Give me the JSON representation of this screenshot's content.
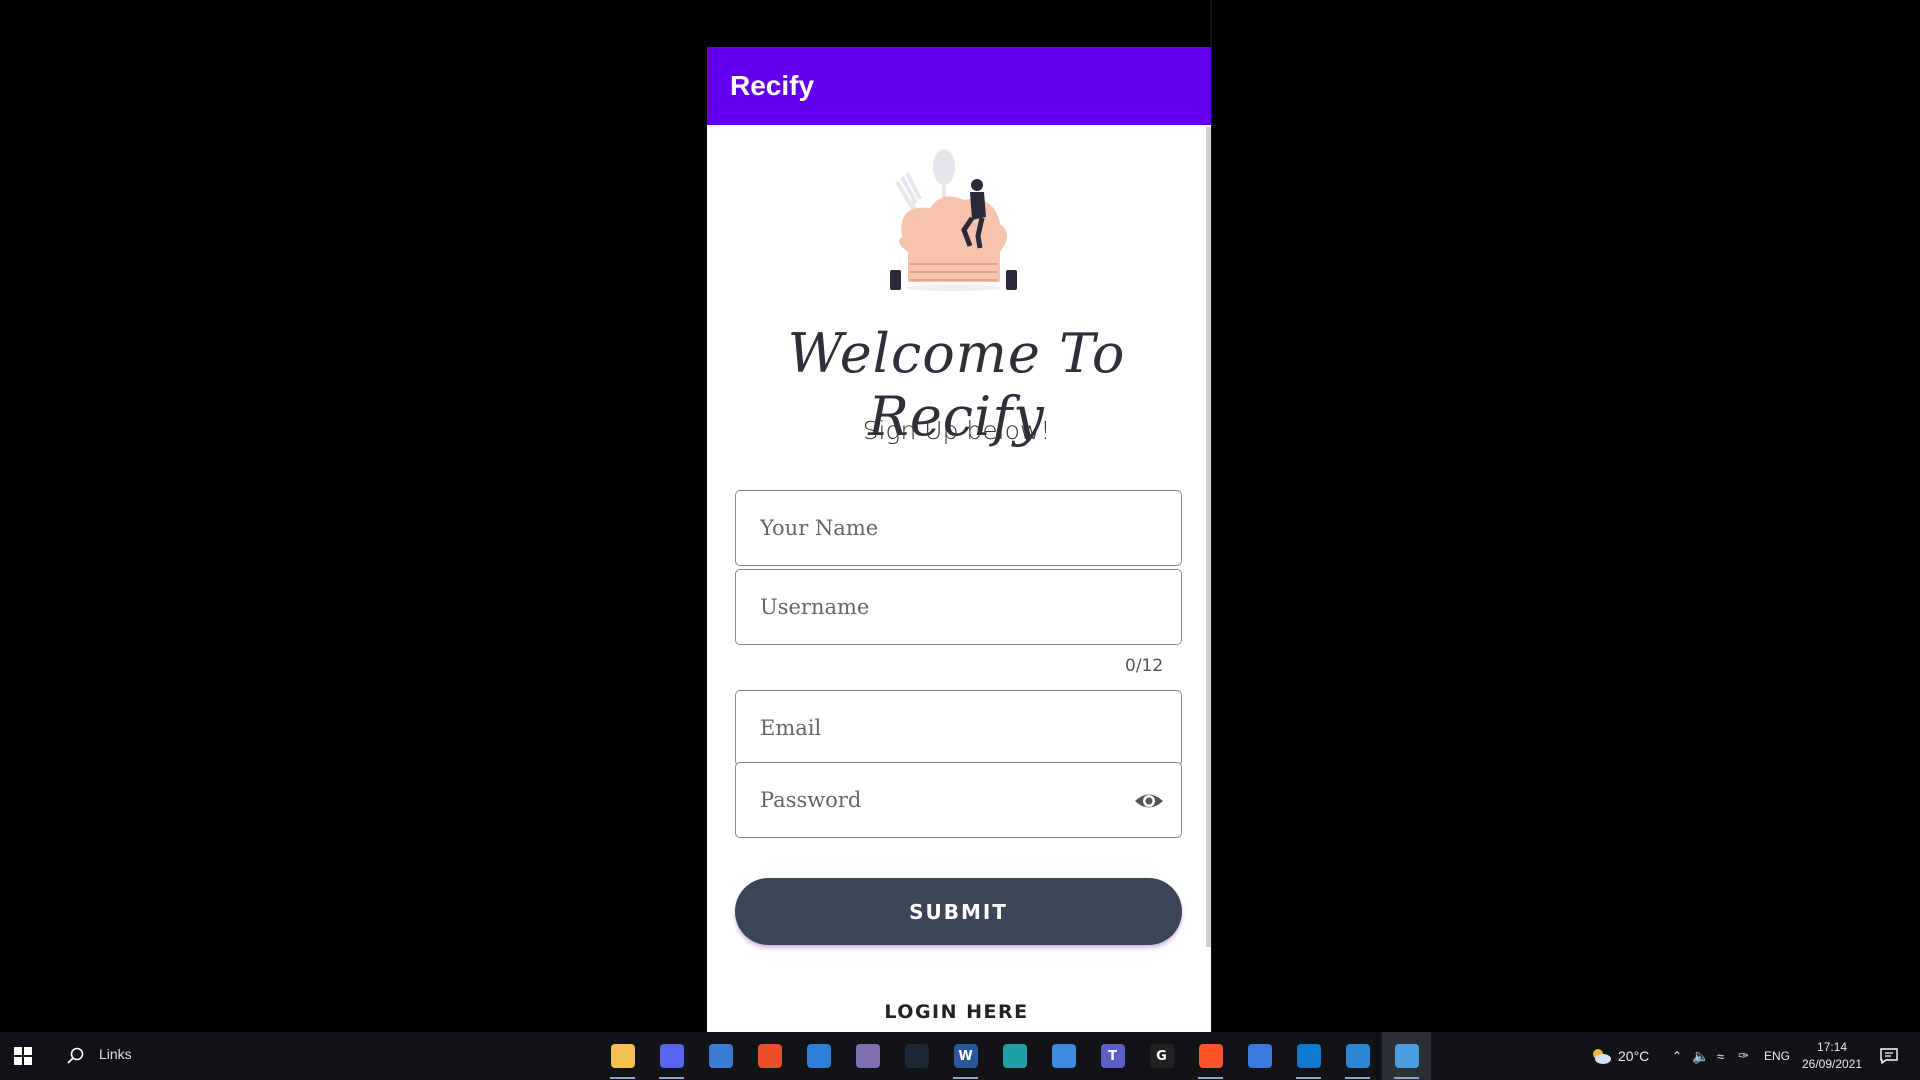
{
  "app": {
    "title": "Recify",
    "welcome": "Welcome To Recify",
    "subtitle": "Sign Up below!"
  },
  "form": {
    "name_placeholder": "Your Name",
    "name_value": "",
    "username_placeholder": "Username",
    "username_value": "",
    "username_counter": "0/12",
    "email_placeholder": "Email",
    "email_value": "",
    "password_placeholder": "Password",
    "password_value": "",
    "submit_label": "SUBMIT",
    "login_label": "LOGIN HERE"
  },
  "colors": {
    "appbar": "#6200ee",
    "submit": "#3b4558"
  },
  "taskbar": {
    "search_label": "Links",
    "apps": [
      {
        "name": "file-explorer-icon",
        "glyph": "",
        "color": "#f2c14e",
        "running": true
      },
      {
        "name": "chat-app-icon",
        "glyph": "",
        "color": "#5865f2",
        "running": true
      },
      {
        "name": "store-icon",
        "glyph": "",
        "color": "#3a7bd5",
        "running": false
      },
      {
        "name": "office-icon",
        "glyph": "",
        "color": "#e8502c",
        "running": false
      },
      {
        "name": "mail-icon",
        "glyph": "",
        "color": "#2f7fd8",
        "running": false
      },
      {
        "name": "terminal-app-icon",
        "glyph": "",
        "color": "#7f6fb0",
        "running": false
      },
      {
        "name": "steam-icon",
        "glyph": "",
        "color": "#1b2838",
        "running": false
      },
      {
        "name": "word-icon",
        "glyph": "W",
        "color": "#2b579a",
        "running": true
      },
      {
        "name": "edge-icon",
        "glyph": "",
        "color": "#1fa0a8",
        "running": false
      },
      {
        "name": "browser-app-icon",
        "glyph": "",
        "color": "#3f8ae0",
        "running": false
      },
      {
        "name": "teams-icon",
        "glyph": "T",
        "color": "#5b5fc7",
        "running": false
      },
      {
        "name": "g-app-icon",
        "glyph": "G",
        "color": "#222222",
        "running": false
      },
      {
        "name": "brave-icon",
        "glyph": "",
        "color": "#fb542b",
        "running": true
      },
      {
        "name": "settings-app-icon",
        "glyph": "",
        "color": "#3a7be0",
        "running": false
      },
      {
        "name": "vscode-icon",
        "glyph": "",
        "color": "#0e7ad0",
        "running": true
      },
      {
        "name": "video-app-icon",
        "glyph": "",
        "color": "#2a87d6",
        "running": true
      },
      {
        "name": "photos-icon",
        "glyph": "",
        "color": "#4a9fe0",
        "running": true,
        "active": true
      }
    ],
    "weather": "20°C",
    "language": "ENG",
    "time": "17:14",
    "date": "26/09/2021",
    "notification_count": ""
  }
}
